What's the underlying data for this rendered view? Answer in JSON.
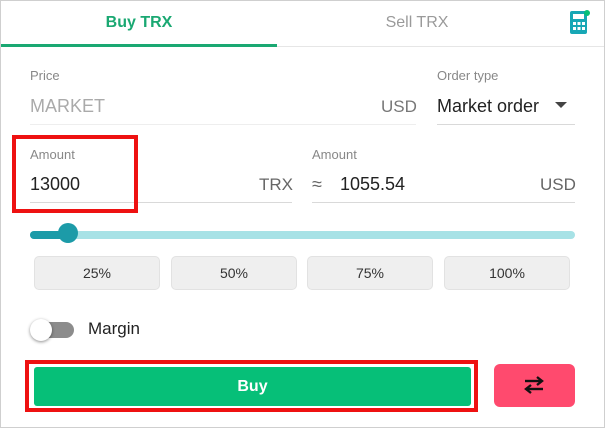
{
  "tabs": {
    "buy_label": "Buy TRX",
    "sell_label": "Sell TRX"
  },
  "icons": {
    "calculator": "calculator-icon",
    "swap": "swap-arrows-icon",
    "dropdown": "caret-down-icon"
  },
  "colors": {
    "primary_green": "#06bf78",
    "tab_green": "#1aa872",
    "slider_accent": "#1c9ba8",
    "slider_track": "#a7e2e6",
    "swap_button": "#ff4a6e",
    "highlight": "#ee1111"
  },
  "price": {
    "label": "Price",
    "value": "MARKET",
    "unit": "USD"
  },
  "order_type": {
    "label": "Order type",
    "value": "Market order"
  },
  "amount_trx": {
    "label": "Amount",
    "value": "13000",
    "unit": "TRX"
  },
  "amount_usd": {
    "label": "Amount",
    "approx": "≈",
    "value": "1055.54",
    "unit": "USD"
  },
  "slider": {
    "fraction": 0.07
  },
  "percent_buttons": [
    "25%",
    "50%",
    "75%",
    "100%"
  ],
  "margin": {
    "label": "Margin",
    "enabled": false
  },
  "buy_button": {
    "label": "Buy"
  }
}
